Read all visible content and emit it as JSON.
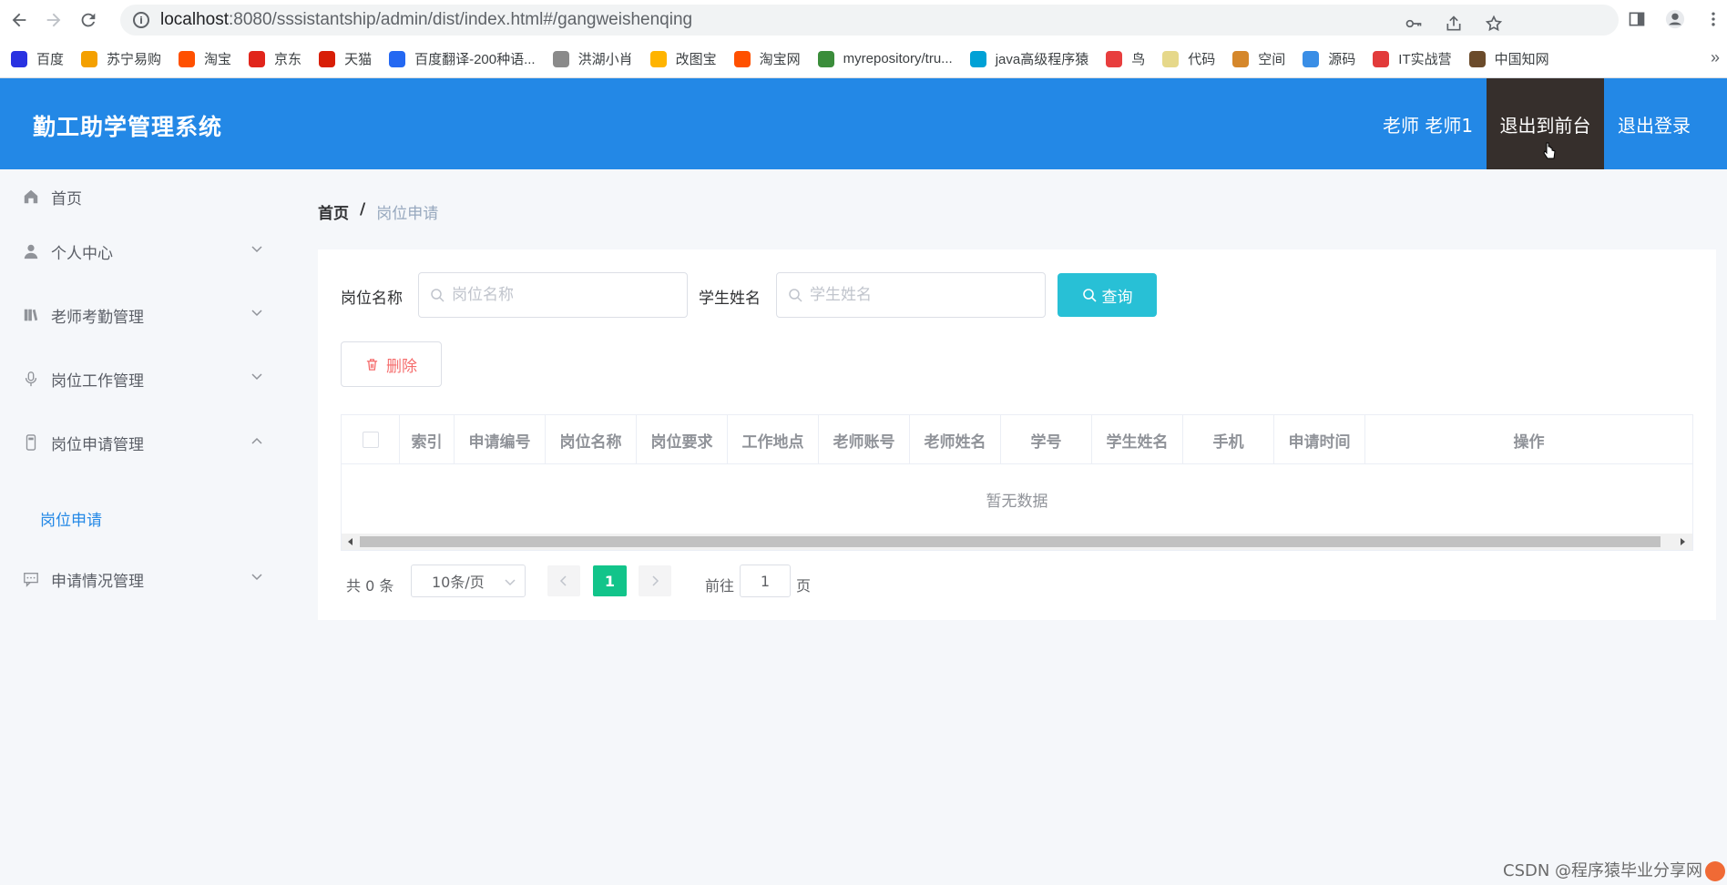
{
  "browser": {
    "url_host": "localhost",
    "url_path": ":8080/sssistantship/admin/dist/index.html#/gangweishenqing",
    "bookmarks": [
      {
        "label": "百度",
        "color": "#2932e1"
      },
      {
        "label": "苏宁易购",
        "color": "#f4a000"
      },
      {
        "label": "淘宝",
        "color": "#ff5000"
      },
      {
        "label": "京东",
        "color": "#e1251b"
      },
      {
        "label": "天猫",
        "color": "#d81e06"
      },
      {
        "label": "百度翻译-200种语...",
        "color": "#2468f2"
      },
      {
        "label": "洪湖小肖",
        "color": "#8a8a8a"
      },
      {
        "label": "改图宝",
        "color": "#ffb400"
      },
      {
        "label": "淘宝网",
        "color": "#ff5000"
      },
      {
        "label": "myrepository/tru...",
        "color": "#3b8d3b"
      },
      {
        "label": "java高级程序猿",
        "color": "#00a1d6"
      },
      {
        "label": "鸟",
        "color": "#e83e3e"
      },
      {
        "label": "代码",
        "color": "#e6d88a"
      },
      {
        "label": "空间",
        "color": "#d5872b"
      },
      {
        "label": "源码",
        "color": "#3a8ee6"
      },
      {
        "label": "IT实战营",
        "color": "#e23b3b"
      },
      {
        "label": "中国知网",
        "color": "#6b4b2b"
      }
    ]
  },
  "header": {
    "title": "勤工助学管理系统",
    "user": "老师 老师1",
    "exit_front": "退出到前台",
    "logout": "退出登录"
  },
  "sidebar": {
    "items": [
      {
        "label": "首页",
        "icon": "home-icon"
      },
      {
        "label": "个人中心",
        "icon": "user-icon"
      },
      {
        "label": "老师考勤管理",
        "icon": "books-icon"
      },
      {
        "label": "岗位工作管理",
        "icon": "microphone-icon"
      },
      {
        "label": "岗位申请管理",
        "icon": "mobile-icon"
      },
      {
        "label": "申请情况管理",
        "icon": "chat-icon"
      }
    ],
    "submenu_active": "岗位申请"
  },
  "breadcrumb": {
    "home": "首页",
    "sep": "/",
    "current": "岗位申请"
  },
  "search": {
    "label1": "岗位名称",
    "placeholder1": "岗位名称",
    "label2": "学生姓名",
    "placeholder2": "学生姓名",
    "button": "查询"
  },
  "actions": {
    "delete": "删除"
  },
  "table": {
    "columns": [
      "索引",
      "申请编号",
      "岗位名称",
      "岗位要求",
      "工作地点",
      "老师账号",
      "老师姓名",
      "学号",
      "学生姓名",
      "手机",
      "申请时间",
      "操作"
    ],
    "empty_text": "暂无数据"
  },
  "pagination": {
    "total": "共 0 条",
    "page_size": "10条/页",
    "current_page": "1",
    "goto_label": "前往",
    "goto_value": "1",
    "page_suffix": "页"
  },
  "watermark": "CSDN @程序猿毕业分享网"
}
